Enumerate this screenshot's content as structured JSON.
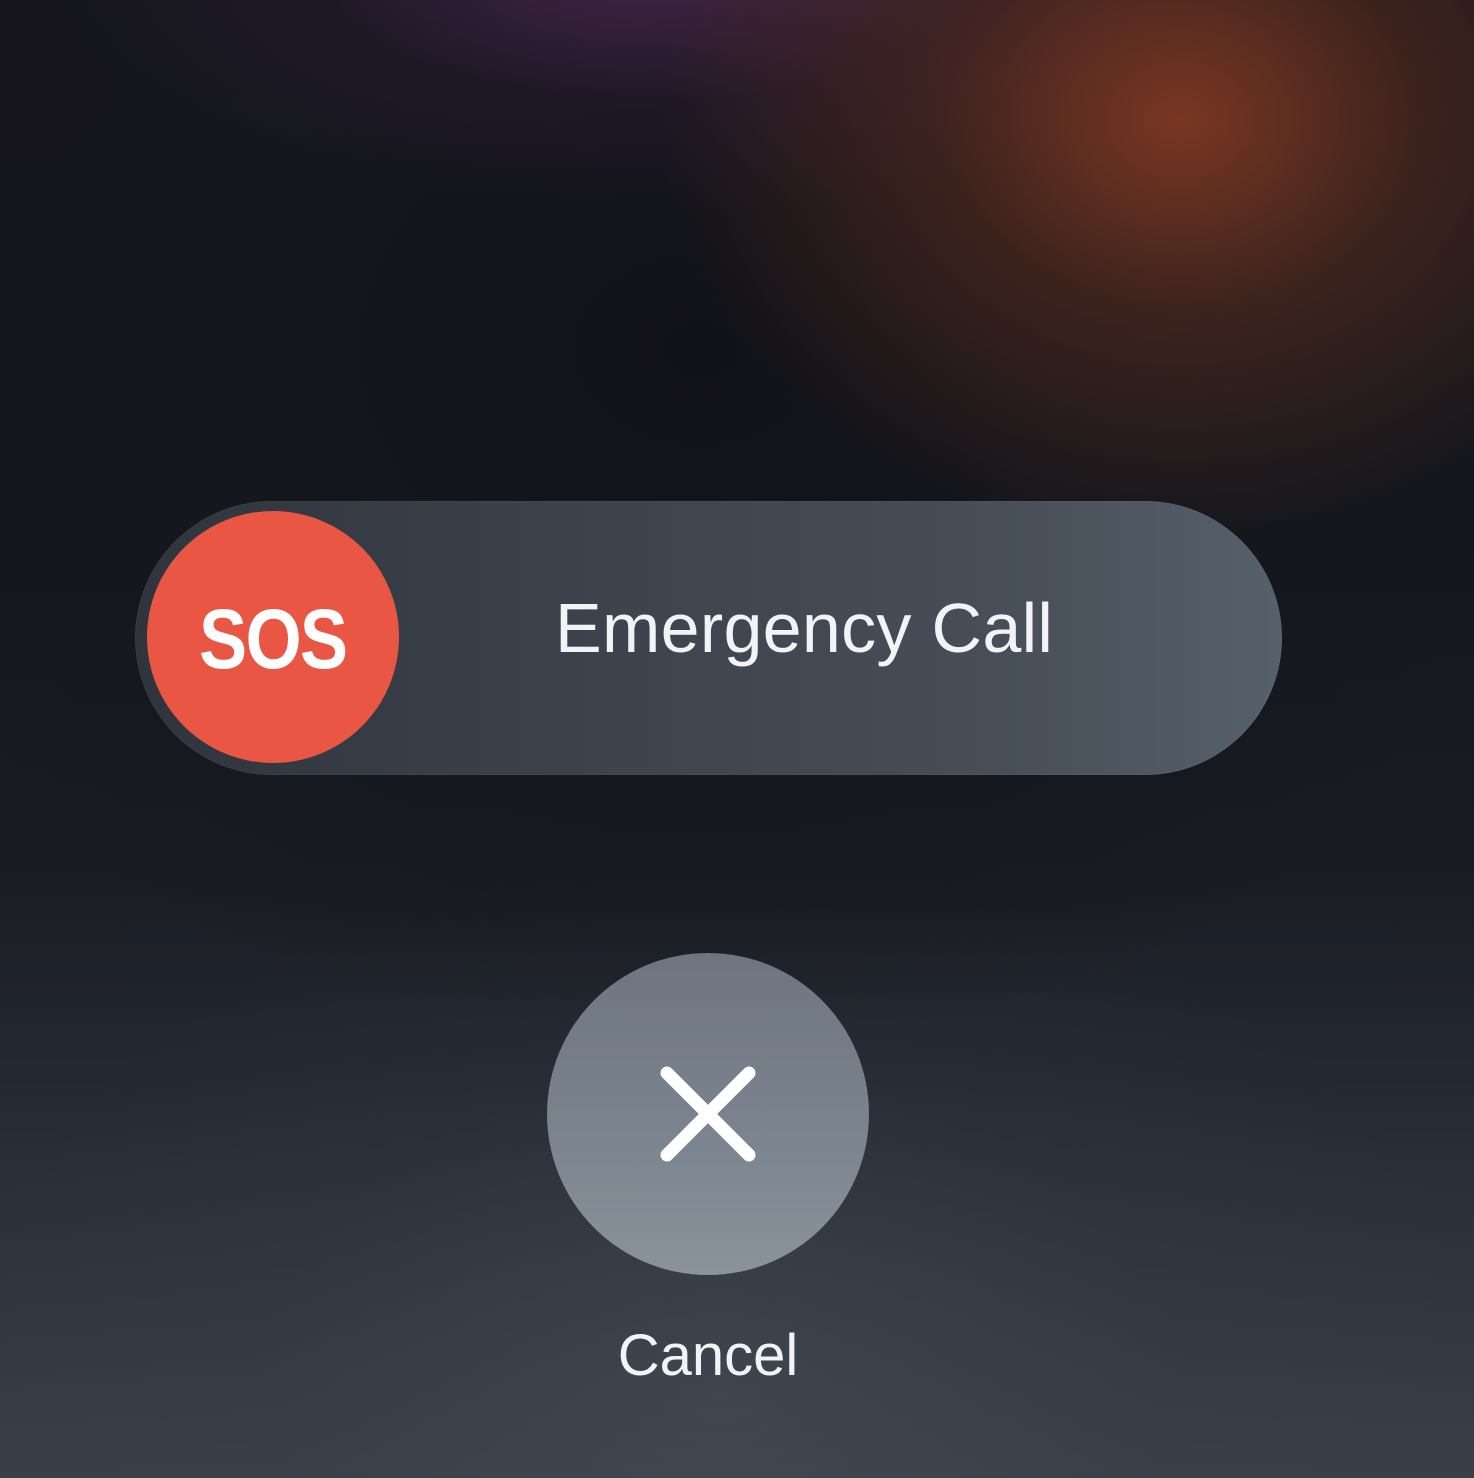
{
  "emergency_slider": {
    "knob_label": "SOS",
    "label": "Emergency Call",
    "knob_color": "#e95744"
  },
  "cancel": {
    "icon": "close-icon",
    "label": "Cancel"
  }
}
